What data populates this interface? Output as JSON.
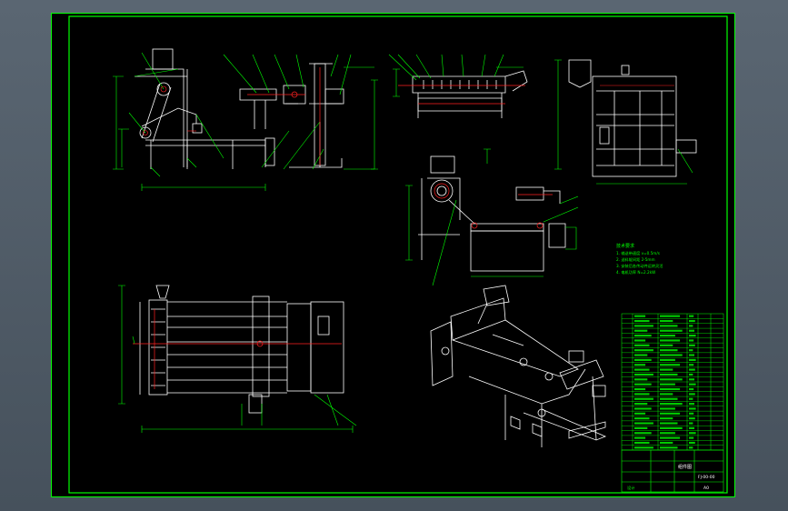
{
  "drawing": {
    "side_note": "技术要求",
    "tech_requirements": [
      "1. 输送带速度 v=0.5m/s",
      "2. 送料辊间距 2-5mm",
      "3. 安装后各传动件运转灵活",
      "4. 电机功率 N=2.2kW"
    ],
    "title_block": {
      "drawing_title": "组件图",
      "drawing_number": "FJ-00-00",
      "scale_code": "A0",
      "designer_label": "设计"
    },
    "parts_list_rows": 28,
    "colors": {
      "frame_border": "#00ff00",
      "geometry": "#ffffff",
      "leader_lines": "#00ff00",
      "centerlines": "#ff2020",
      "background": "#000000",
      "viewport": "#5a6672"
    }
  }
}
